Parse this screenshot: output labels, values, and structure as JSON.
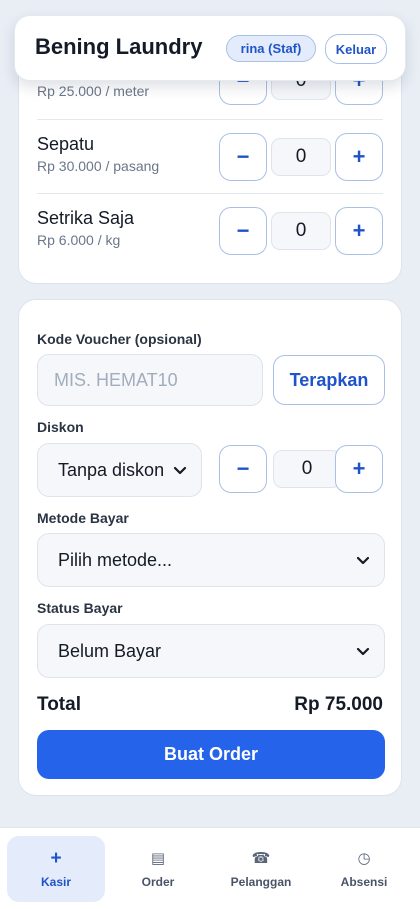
{
  "header": {
    "brand": "Bening Laundry",
    "user_badge": "rina (Staf)",
    "logout_label": "Keluar"
  },
  "services": [
    {
      "name": "",
      "price": "Rp 25.000 / meter",
      "qty": "0"
    },
    {
      "name": "Sepatu",
      "price": "Rp 30.000 / pasang",
      "qty": "0"
    },
    {
      "name": "Setrika Saja",
      "price": "Rp 6.000 / kg",
      "qty": "0"
    }
  ],
  "stepper": {
    "minus": "−",
    "plus": "+"
  },
  "voucher": {
    "label": "Kode Voucher (opsional)",
    "placeholder": "MIS. HEMAT10",
    "apply_label": "Terapkan"
  },
  "discount": {
    "label": "Diskon",
    "selected": "Tanpa diskon",
    "qty": "0"
  },
  "payment_method": {
    "label": "Metode Bayar",
    "selected": "Pilih metode..."
  },
  "payment_status": {
    "label": "Status Bayar",
    "selected": "Belum Bayar"
  },
  "total": {
    "label": "Total",
    "value": "Rp 75.000"
  },
  "submit_label": "Buat Order",
  "nav": {
    "items": [
      {
        "label": "Kasir",
        "icon": "+",
        "icon_name": "plus-icon",
        "active": true
      },
      {
        "label": "Order",
        "icon": "▤",
        "icon_name": "list-icon",
        "active": false
      },
      {
        "label": "Pelanggan",
        "icon": "☎",
        "icon_name": "phone-icon",
        "active": false
      },
      {
        "label": "Absensi",
        "icon": "◷",
        "icon_name": "clock-icon",
        "active": false
      }
    ]
  },
  "colors": {
    "primary": "#2563eb",
    "accent_text": "#1f54c9",
    "page_bg": "#e9eef5",
    "active_nav_bg": "#e4ecfb"
  }
}
